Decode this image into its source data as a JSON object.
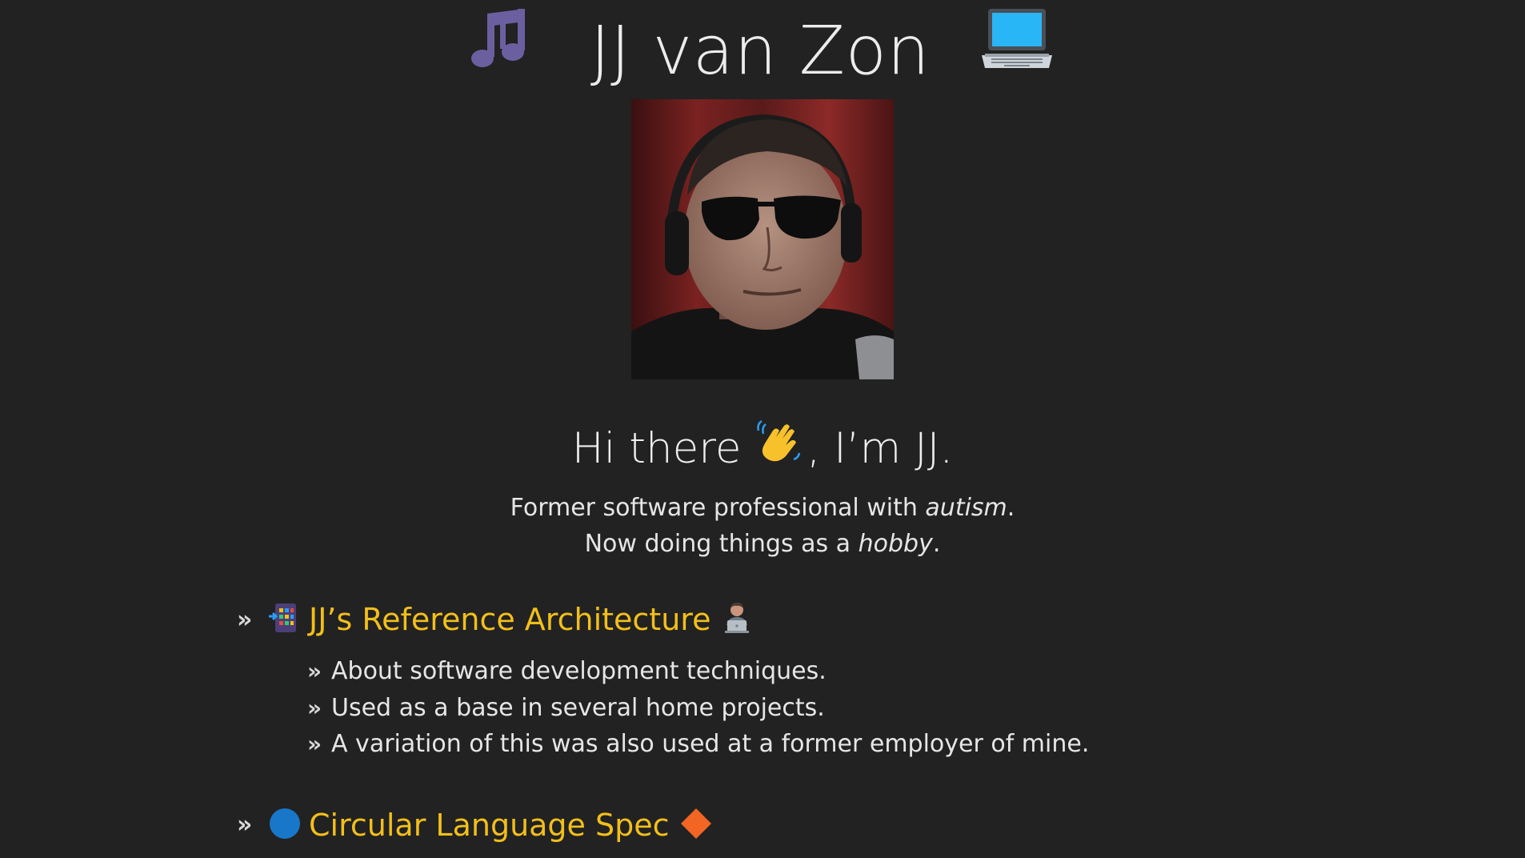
{
  "site": {
    "title": "JJ van Zon",
    "left_icon": "music-notes-icon",
    "right_icon": "laptop-icon"
  },
  "greeting": {
    "prefix": "Hi there",
    "suffix": ", I’m JJ.",
    "icon": "waving-hand-icon"
  },
  "intro": {
    "line1_prefix": "Former software professional with ",
    "line1_em": "autism",
    "line1_suffix": ".",
    "line2_prefix": "Now doing things as a ",
    "line2_em": "hobby",
    "line2_suffix": "."
  },
  "projects": [
    {
      "title": "JJ’s Reference Architecture",
      "icon_left": "architecture-grid-icon",
      "icon_right": "technologist-icon",
      "bullets": [
        "About software development techniques.",
        "Used as a base in several home projects.",
        "A variation of this was also used at a former employer of mine."
      ]
    },
    {
      "title": "Circular Language Spec",
      "icon_left": "blue-circle-icon",
      "icon_right": "orange-diamond-icon",
      "bullets": []
    }
  ],
  "glyphs": {
    "raquo": "»"
  },
  "colors": {
    "background": "#222222",
    "link": "#f2bf1b",
    "text": "#e6e6e6"
  }
}
